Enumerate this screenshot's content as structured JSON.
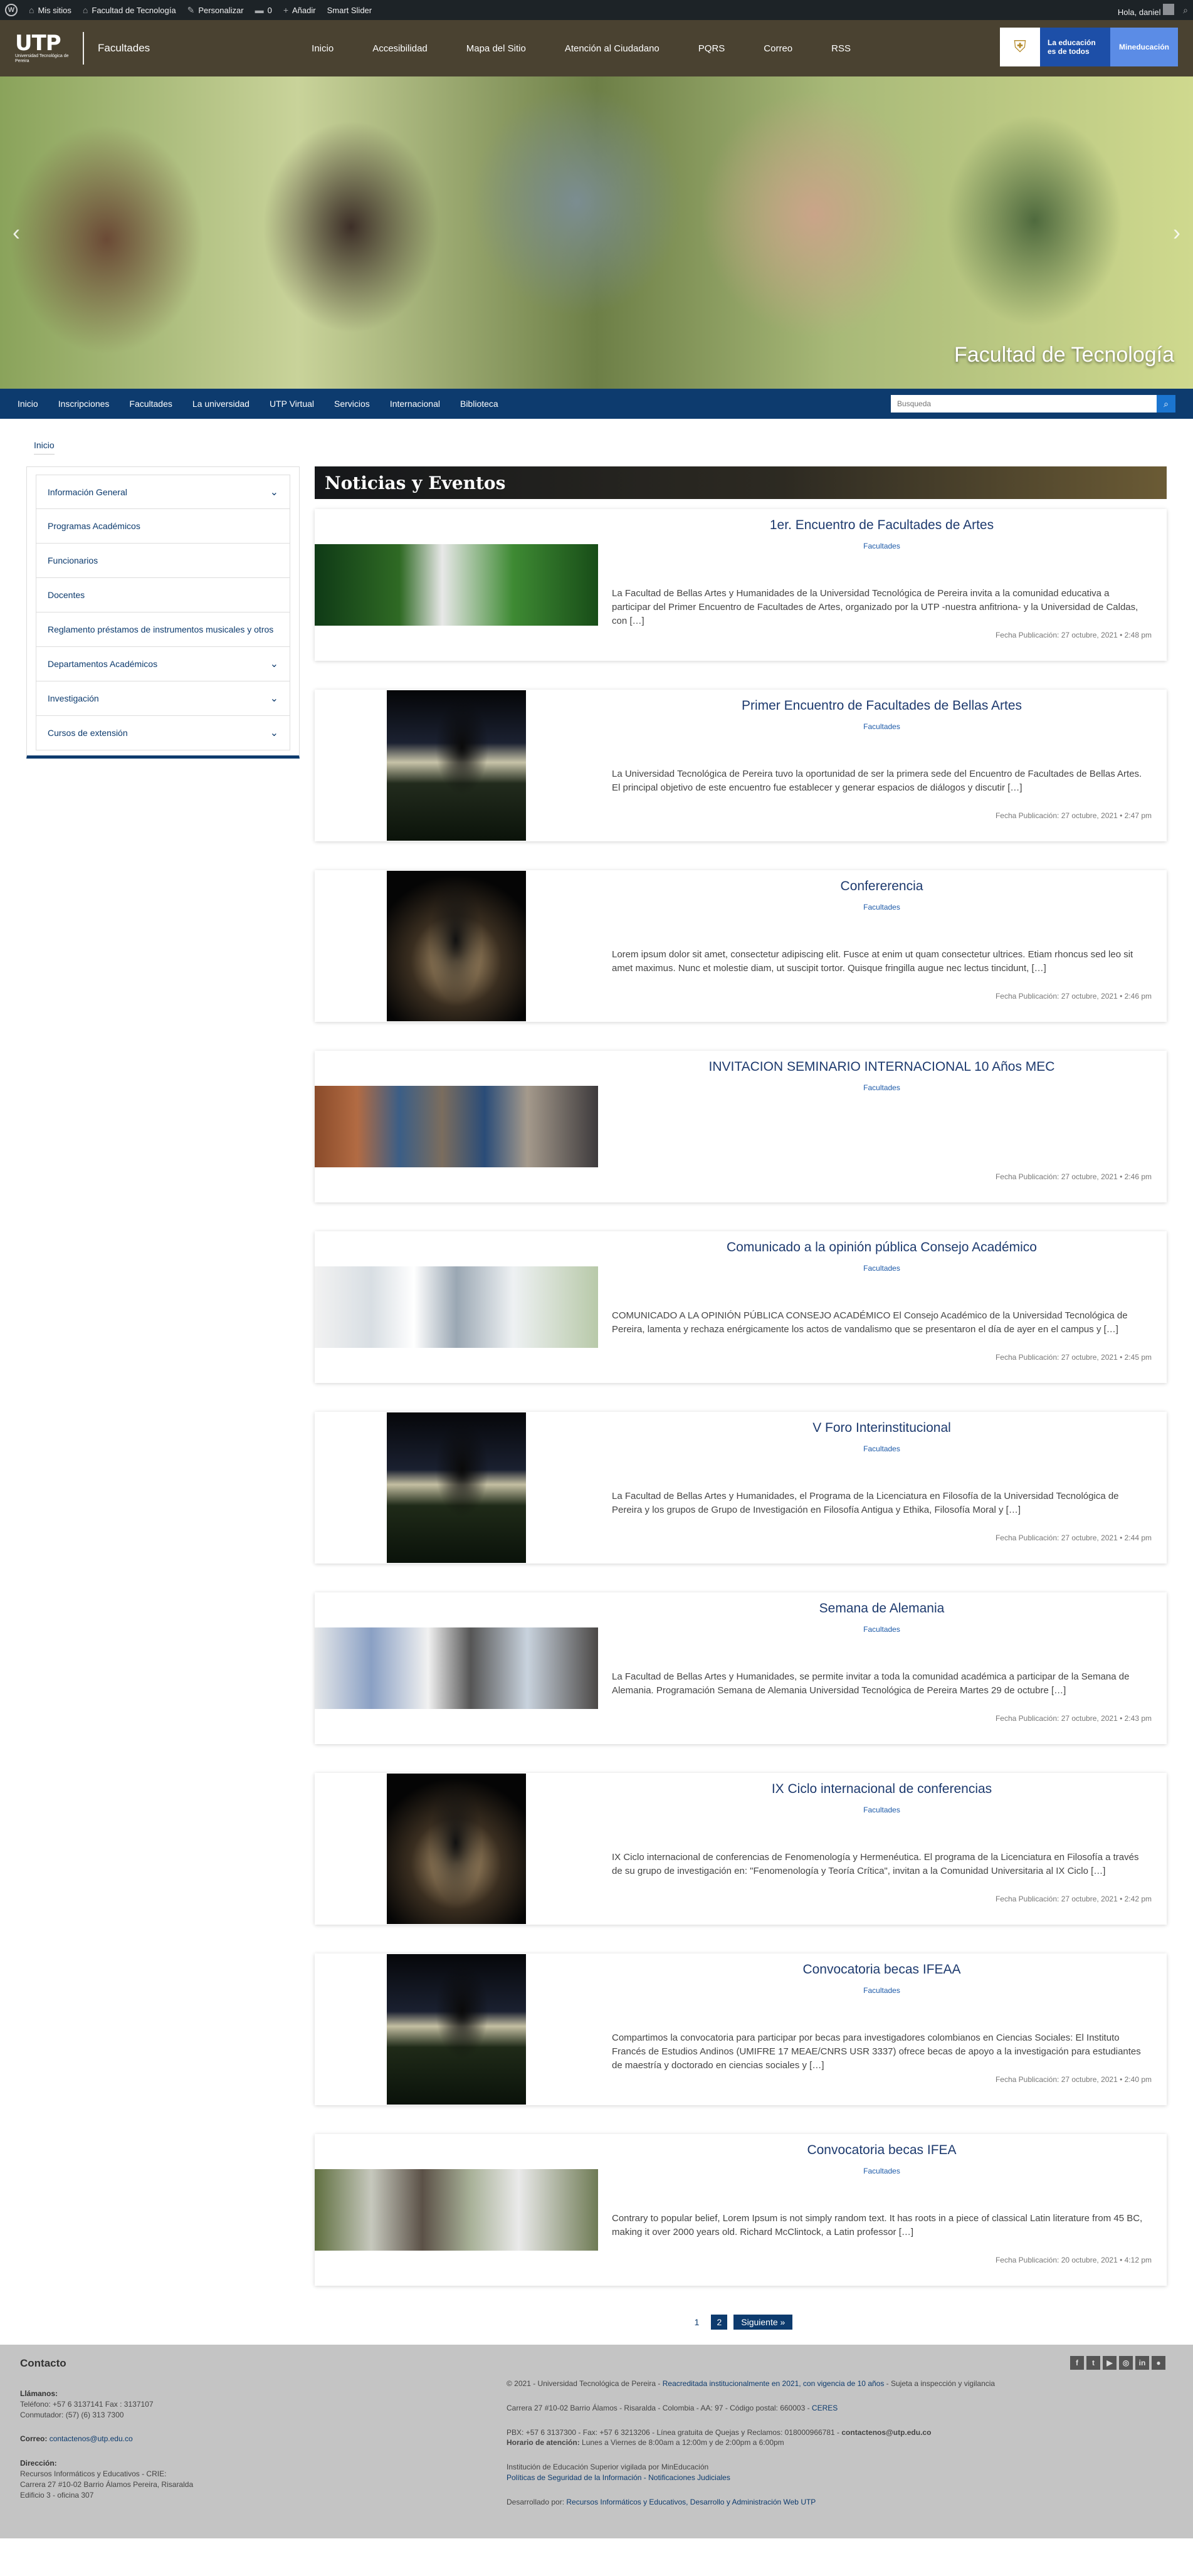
{
  "adminbar": {
    "my_sites": "Mis sitios",
    "site": "Facultad de Tecnología",
    "customize": "Personalizar",
    "comments": "0",
    "add": "Añadir",
    "slider": "Smart Slider",
    "greeting": "Hola, daniel"
  },
  "header": {
    "logo": "UTP",
    "logo_sub": "Universidad Tecnológica de Pereira",
    "site": "Facultades",
    "nav": [
      "Inicio",
      "Accesibilidad",
      "Mapa del Sitio",
      "Atención al Ciudadano",
      "PQRS",
      "Correo",
      "RSS"
    ],
    "gov_text": "La educación es de todos",
    "gov_ministry": "Mineducación"
  },
  "hero": {
    "caption": "Facultad de Tecnología"
  },
  "secnav": {
    "items": [
      "Inicio",
      "Inscripciones",
      "Facultades",
      "La universidad",
      "UTP Virtual",
      "Servicios",
      "Internacional",
      "Biblioteca"
    ],
    "search_placeholder": "Busqueda"
  },
  "breadcrumb": "Inicio",
  "sidebar": [
    {
      "label": "Información General",
      "expandable": true
    },
    {
      "label": "Programas Académicos",
      "expandable": false
    },
    {
      "label": "Funcionarios",
      "expandable": false
    },
    {
      "label": "Docentes",
      "expandable": false
    },
    {
      "label": "Reglamento préstamos de instrumentos musicales y otros",
      "expandable": false
    },
    {
      "label": "Departamentos Académicos",
      "expandable": true
    },
    {
      "label": "Investigación",
      "expandable": true
    },
    {
      "label": "Cursos de extensión",
      "expandable": true
    }
  ],
  "section_title": "Noticias y Eventos",
  "posts": [
    {
      "title": "1er. Encuentro de Facultades de Artes",
      "category": "Facultades",
      "excerpt": "La Facultad de Bellas  Artes y Humanidades de la Universidad Tecnológica de Pereira invita a la comunidad educativa a participar del Primer Encuentro de Facultades de Artes, organizado por la UTP -nuestra anfitriona- y la Universidad de Caldas, con […]",
      "date": "Fecha Publicación: 27 octubre, 2021 • 2:48 pm"
    },
    {
      "title": "Primer Encuentro de Facultades de Bellas Artes",
      "category": "Facultades",
      "excerpt": "La Universidad Tecnológica de Pereira tuvo la oportunidad  de ser la primera sede del Encuentro de Facultades de Bellas Artes. El principal objetivo de este encuentro fue establecer y generar espacios de diálogos y discutir […]",
      "date": "Fecha Publicación: 27 octubre, 2021 • 2:47 pm"
    },
    {
      "title": "Confererencia",
      "category": "Facultades",
      "excerpt": "Lorem ipsum dolor sit amet, consectetur adipiscing elit. Fusce at enim ut quam consectetur ultrices. Etiam rhoncus sed leo sit amet maximus. Nunc et molestie diam, ut suscipit tortor. Quisque fringilla augue nec lectus tincidunt, […]",
      "date": "Fecha Publicación: 27 octubre, 2021 • 2:46 pm"
    },
    {
      "title": "INVITACION SEMINARIO INTERNACIONAL 10 Años MEC",
      "category": "Facultades",
      "excerpt": "",
      "date": "Fecha Publicación: 27 octubre, 2021 • 2:46 pm"
    },
    {
      "title": "Comunicado a la opinión pública Consejo Académico",
      "category": "Facultades",
      "excerpt": "COMUNICADO A LA OPINIÓN PÚBLICA CONSEJO ACADÉMICO El Consejo Académico de la Universidad Tecnológica de Pereira, lamenta y rechaza enérgicamente los actos de vandalismo que se presentaron el día de ayer en el campus y […]",
      "date": "Fecha Publicación: 27 octubre, 2021 • 2:45 pm"
    },
    {
      "title": "V Foro Interinstitucional",
      "category": "Facultades",
      "excerpt": "La Facultad de Bellas Artes y Humanidades, el Programa de la Licenciatura en Filosofía de la Universidad Tecnológica de Pereira y los grupos de Grupo de Investigación en Filosofía Antigua y Ethika, Filosofía Moral y […]",
      "date": "Fecha Publicación: 27 octubre, 2021 • 2:44 pm"
    },
    {
      "title": "Semana de Alemania",
      "category": "Facultades",
      "excerpt": "La Facultad de Bellas Artes y Humanidades, se permite invitar a toda la comunidad académica a participar de la Semana de Alemania.    Programación Semana de Alemania Universidad Tecnológica de Pereira Martes 29 de octubre […]",
      "date": "Fecha Publicación: 27 octubre, 2021 • 2:43 pm"
    },
    {
      "title": "IX Ciclo internacional de conferencias",
      "category": "Facultades",
      "excerpt": " IX Ciclo internacional de conferencias de Fenomenología y Hermenéutica.  El programa de la Licenciatura en Filosofía a través de su grupo de investigación en: \"Fenomenología y Teoría Crítica\", invitan a la Comunidad Universitaria  al IX Ciclo […]",
      "date": "Fecha Publicación: 27 octubre, 2021 • 2:42 pm"
    },
    {
      "title": "Convocatoria becas IFEAA",
      "category": "Facultades",
      "excerpt": "Compartimos la convocatoria para participar por becas para investigadores colombianos en Ciencias Sociales: El Instituto Francés de Estudios Andinos (UMIFRE 17 MEAE/CNRS USR 3337) ofrece becas de apoyo a la investigación  para  estudiantes de maestría y doctorado en ciencias sociales y […]",
      "date": "Fecha Publicación: 27 octubre, 2021 • 2:40 pm"
    },
    {
      "title": "Convocatoria becas IFEA",
      "category": "Facultades",
      "excerpt": "Contrary to popular belief, Lorem Ipsum is not simply random text. It has roots in a piece of classical Latin literature from 45 BC, making it over 2000 years old. Richard McClintock, a Latin professor […]",
      "date": "Fecha Publicación: 20 octubre, 2021 • 4:12 pm"
    }
  ],
  "pager": {
    "p1": "1",
    "p2": "2",
    "next": "Siguiente »"
  },
  "footer": {
    "title": "Contacto",
    "llamanos_label": "Llámanos:",
    "phone1": "Teléfono: +57 6 3137141 Fax : 3137107",
    "phone2": "Conmutador: (57) (6) 313 7300",
    "mail_label": "Correo:",
    "mail": "contactenos@utp.edu.co",
    "dir_label": "Dirección:",
    "dir1": "Recursos Informáticos y Educativos - CRIE:",
    "dir2": "Carrera 27 #10-02 Barrio Álamos Pereira, Risaralda",
    "dir3": "Edificio 3 - oficina 307",
    "r1a": "© 2021 - Universidad Tecnológica de Pereira - ",
    "r1b": "Reacreditada institucionalmente en 2021, con vigencia de 10 años",
    "r1c": " - Sujeta a inspección y vigilancia",
    "r2a": "Carrera 27 #10-02 Barrio Álamos - Risaralda - Colombia - AA: 97 - Código postal: 660003 - ",
    "r2b": "CERES",
    "r3a": "PBX: +57 6 3137300 - Fax: +57 6 3213206 - Línea gratuita de Quejas y Reclamos: 018000966781 - ",
    "r3b": "contactenos@utp.edu.co",
    "r4a": "Horario de atención:",
    "r4b": " Lunes a Viernes de 8:00am a 12:00m y de 2:00pm a 6:00pm",
    "r5": "Institución de Educación Superior vigilada por MinEducación",
    "r6": "Políticas de Seguridad de la Información - Notificaciones Judiciales",
    "r7a": "Desarrollado por: ",
    "r7b": "Recursos Informáticos y Educativos, Desarrollo y Administración Web UTP"
  }
}
